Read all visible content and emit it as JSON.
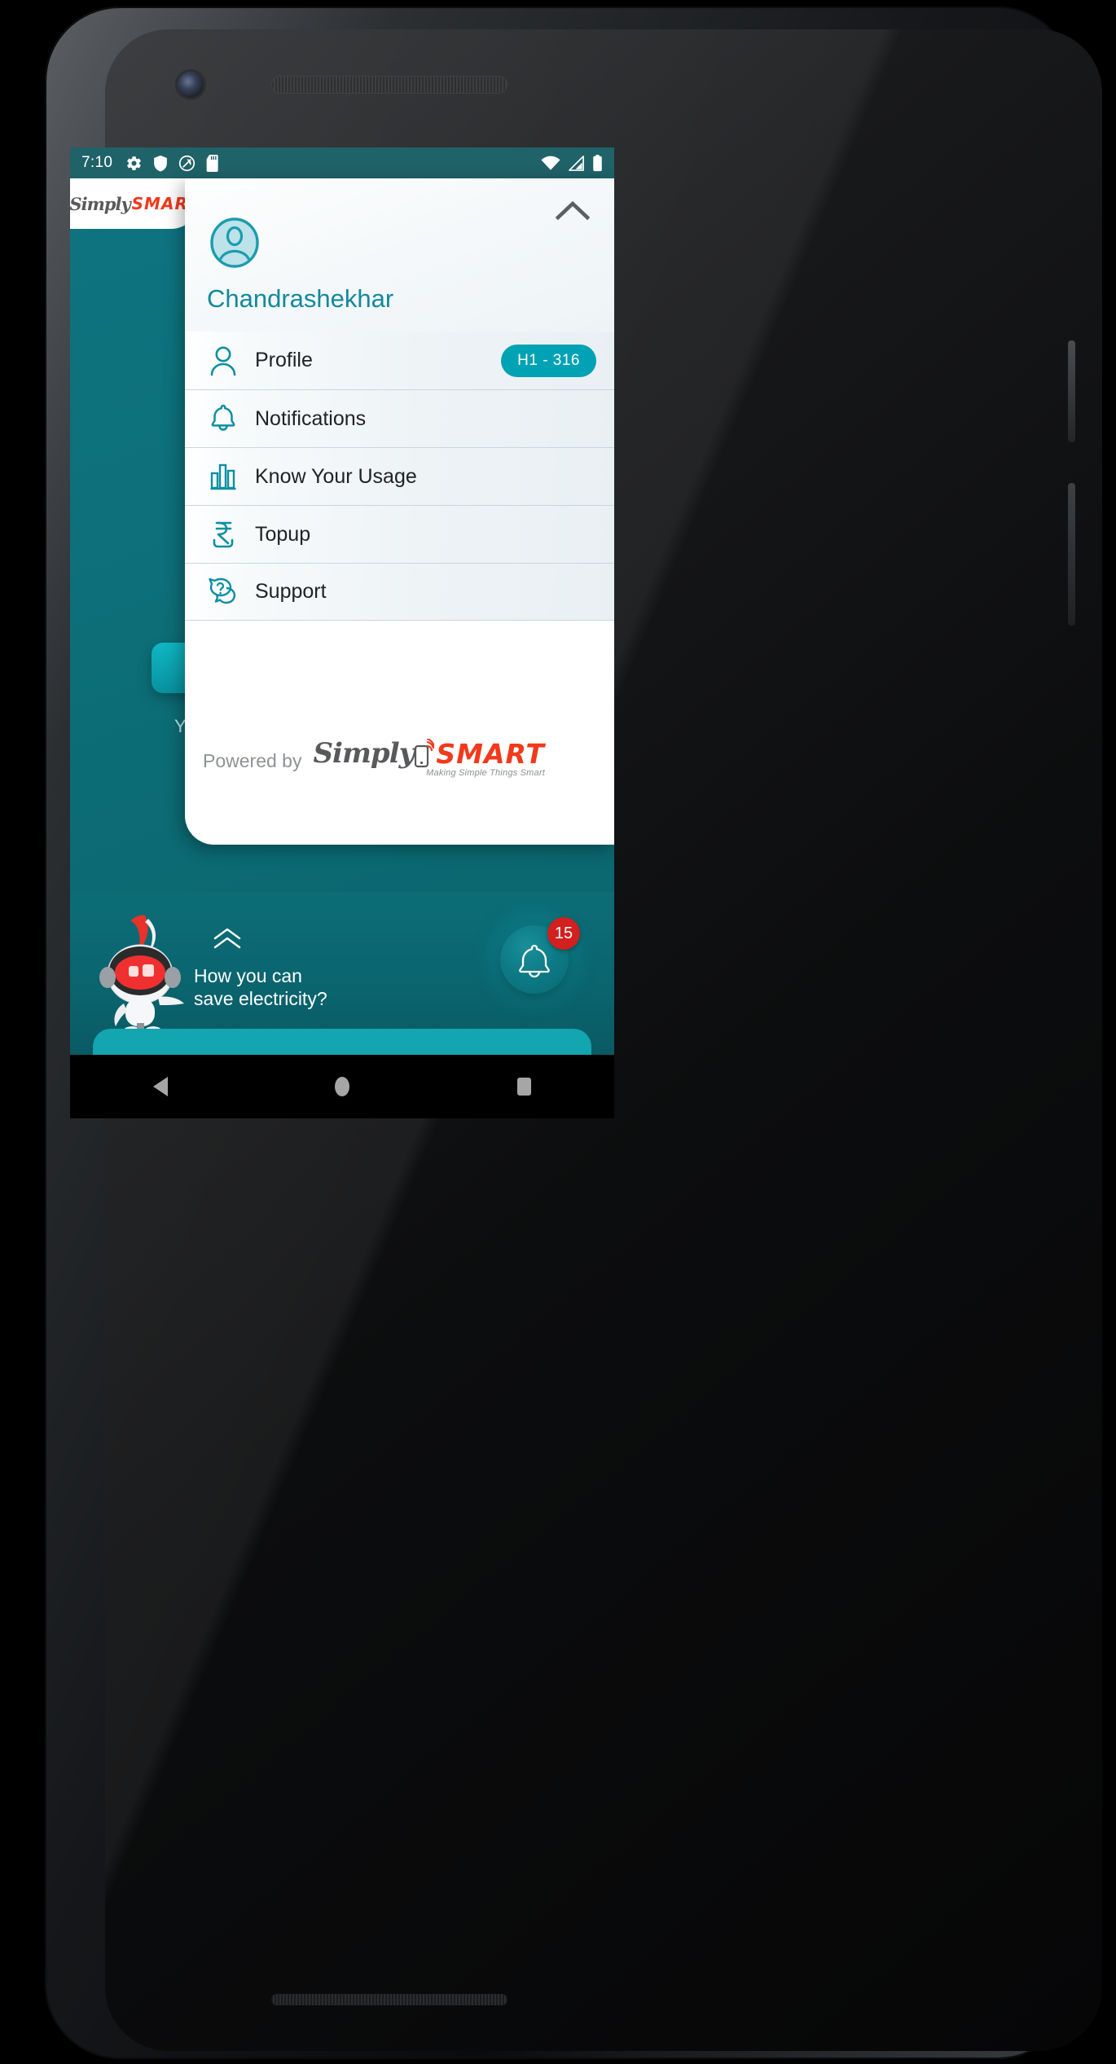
{
  "status_bar": {
    "time": "7:10",
    "left_icons": [
      "gear-icon",
      "shield-icon",
      "do-not-disturb-icon",
      "sd-card-icon"
    ],
    "right_icons": [
      "wifi-icon",
      "cellular-signal-icon",
      "battery-icon"
    ]
  },
  "brand": {
    "logo_script": "Simply",
    "logo_bold": "SMART",
    "tagline": "Making Simple Things Smart",
    "script_color": "#58595b",
    "bold_color": "#f1391c"
  },
  "drawer": {
    "collapse_icon": "chevron-up-icon",
    "avatar_icon": "user-avatar-icon",
    "username": "Chandrashekhar",
    "accent_color": "#12899b",
    "items": [
      {
        "icon": "person-icon",
        "label": "Profile",
        "badge": "H1 - 316"
      },
      {
        "icon": "bell-icon",
        "label": "Notifications",
        "badge": ""
      },
      {
        "icon": "bar-chart-icon",
        "label": "Know Your Usage",
        "badge": ""
      },
      {
        "icon": "rupee-icon",
        "label": "Topup",
        "badge": ""
      },
      {
        "icon": "support-chat-icon",
        "label": "Support",
        "badge": ""
      }
    ],
    "badge_color": "#00a2b4",
    "footer_text": "Powered by"
  },
  "home": {
    "caption_partial": "You",
    "background_color": "#0d6f79"
  },
  "assistant": {
    "mascot": "robot-mascot-icon",
    "expand_icon": "double-chevron-up-icon",
    "message_line1": "How you can",
    "message_line2": "save electricity?",
    "bell_icon": "bell-icon",
    "notification_count": "15",
    "badge_color": "#d21f1f"
  },
  "android_nav": {
    "back": "back-triangle-icon",
    "home": "home-circle-icon",
    "recents": "recents-square-icon"
  }
}
